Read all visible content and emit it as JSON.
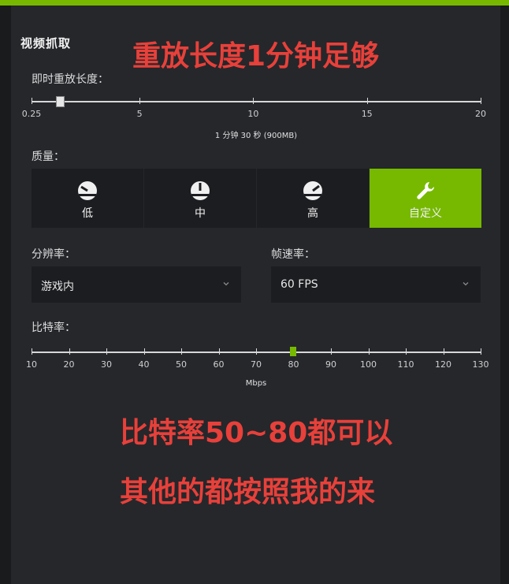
{
  "overlay": {
    "line1": "重放长度1分钟足够",
    "line2": "比特率50~80都可以",
    "line3": "其他的都按照我的来"
  },
  "capture": {
    "section_title": "视频抓取",
    "replay_label": "即时重放长度：",
    "replay_ticks": [
      "0.25",
      "5",
      "10",
      "15",
      "20"
    ],
    "replay_minutes": 1.5,
    "replay_caption": "1 分钟 30 秒 (900MB)",
    "quality_label": "质量：",
    "quality_options": [
      "低",
      "中",
      "高",
      "自定义"
    ],
    "quality_selected": "自定义",
    "resolution_label": "分辨率：",
    "resolution_value": "游戏内",
    "framerate_label": "帧速率：",
    "framerate_value": "60 FPS",
    "bitrate_label": "比特率：",
    "bitrate_ticks": [
      "10",
      "20",
      "30",
      "40",
      "50",
      "60",
      "70",
      "80",
      "90",
      "100",
      "110",
      "120",
      "130"
    ],
    "bitrate_value": 80,
    "bitrate_unit": "Mbps"
  },
  "colors": {
    "accent": "#76b900",
    "overlay_text": "#e8403a"
  },
  "icons": {
    "quality_low": "gauge-low-icon",
    "quality_mid": "gauge-mid-icon",
    "quality_high": "gauge-high-icon",
    "quality_custom": "wrench-icon",
    "dropdown": "chevron-down-icon"
  }
}
